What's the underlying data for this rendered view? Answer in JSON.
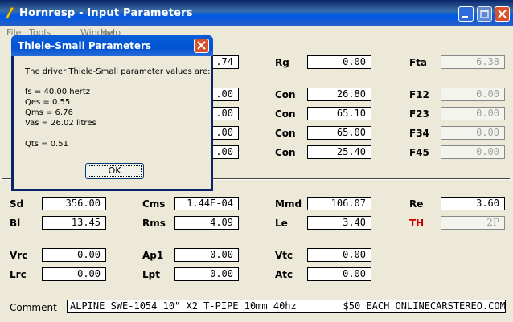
{
  "window": {
    "title": "Hornresp - Input Parameters"
  },
  "menu": [
    "File",
    "Tools",
    "Window",
    "Help"
  ],
  "col1": {
    "sd_label": "Sd",
    "sd_value": "356.00",
    "bl_label": "Bl",
    "bl_value": "13.45",
    "vrc_label": "Vrc",
    "vrc_value": "0.00",
    "lrc_label": "Lrc",
    "lrc_value": "0.00"
  },
  "col2": {
    "top_value": ".74",
    "r1_value": ".00",
    "r2_value": ".00",
    "r3_value": ".00",
    "r4_value": ".00",
    "cms_label": "Cms",
    "cms_value": "1.44E-04",
    "rms_label": "Rms",
    "rms_value": "4.09",
    "ap1_label": "Ap1",
    "ap1_value": "0.00",
    "lpt_label": "Lpt",
    "lpt_value": "0.00"
  },
  "col3": {
    "rg_label": "Rg",
    "rg_value": "0.00",
    "con_label": "Con",
    "con1_value": "26.80",
    "con2_value": "65.10",
    "con3_value": "65.00",
    "con4_value": "25.40",
    "mmd_label": "Mmd",
    "mmd_value": "106.07",
    "le_label": "Le",
    "le_value": "3.40",
    "vtc_label": "Vtc",
    "vtc_value": "0.00",
    "atc_label": "Atc",
    "atc_value": "0.00"
  },
  "col4": {
    "fta_label": "Fta",
    "fta_value": "6.38",
    "f12_label": "F12",
    "f12_value": "0.00",
    "f23_label": "F23",
    "f23_value": "0.00",
    "f34_label": "F34",
    "f34_value": "0.00",
    "f45_label": "F45",
    "f45_value": "0.00",
    "re_label": "Re",
    "re_value": "3.60",
    "th_label": "TH",
    "th_value": "2P"
  },
  "comment": {
    "label": "Comment",
    "value": "ALPINE SWE-1054 10\" X2 T-PIPE 10mm 40hz        $50 EACH ONLINECARSTEREO.COM"
  },
  "dialog": {
    "title": "Thiele-Small Parameters",
    "intro": "The driver Thiele-Small parameter values are:",
    "fs": "fs = 40.00 hertz",
    "qes": "Qes = 0.55",
    "qms": "Qms = 6.76",
    "vas": "Vas = 26.02 litres",
    "qts": "Qts = 0.51",
    "ok_label": "OK"
  },
  "colors": {
    "title_bar": "#0058e6",
    "th_label": "#cc0000",
    "face": "#ece9d8"
  }
}
